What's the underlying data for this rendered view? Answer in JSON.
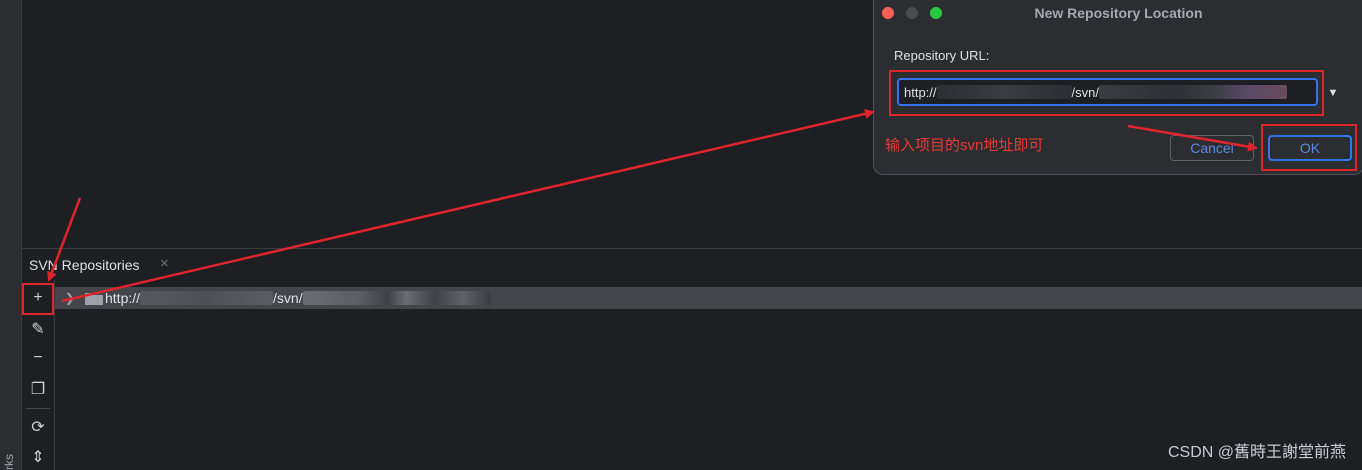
{
  "left_stripe": {
    "label": "rks"
  },
  "tool_window": {
    "title": "SVN Repositories",
    "close_glyph": "×",
    "toolbar": [
      {
        "name": "add-icon",
        "glyph": "+"
      },
      {
        "name": "edit-icon",
        "glyph": "✎"
      },
      {
        "name": "remove-icon",
        "glyph": "−"
      },
      {
        "name": "copy-icon",
        "glyph": "❐"
      },
      {
        "name": "refresh-icon",
        "glyph": "⟳"
      },
      {
        "name": "collapse-icon",
        "glyph": "⇕"
      }
    ],
    "tree": {
      "row_prefix": "http://",
      "row_middle": "/svn/"
    }
  },
  "dialog": {
    "title": "New Repository Location",
    "field_label": "Repository URL:",
    "url_prefix": "http://",
    "url_middle": "/svn/",
    "cancel_label": "Cancel",
    "ok_label": "OK"
  },
  "annotation": {
    "text": "输入项目的svn地址即可"
  },
  "watermark": "CSDN @舊時王謝堂前燕",
  "colors": {
    "accent": "#3574f0",
    "annotation_red": "#e0242b",
    "background": "#1e1f22",
    "panel": "#2b2d30"
  }
}
